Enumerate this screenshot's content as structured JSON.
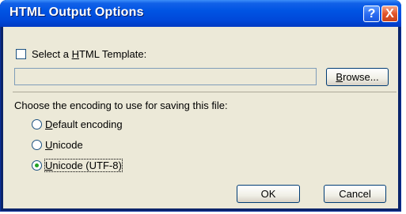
{
  "window": {
    "title": "HTML Output Options",
    "help_glyph": "?",
    "close_glyph": "X"
  },
  "template": {
    "checkbox_label_pre": "Select a ",
    "checkbox_label_mnemonic": "H",
    "checkbox_label_post": "TML Template:",
    "checked": false,
    "path_value": ""
  },
  "browse_button": {
    "mnemonic": "B",
    "rest": "rowse..."
  },
  "encoding": {
    "prompt": "Choose the encoding to use for saving this file:",
    "options": [
      {
        "mnemonic": "D",
        "rest": "efault encoding",
        "selected": false
      },
      {
        "mnemonic": "U",
        "rest": "nicode",
        "selected": false
      },
      {
        "mnemonic": "U",
        "rest": "nicode (UTF-8)",
        "selected": true
      }
    ]
  },
  "buttons": {
    "ok": "OK",
    "cancel": "Cancel"
  }
}
